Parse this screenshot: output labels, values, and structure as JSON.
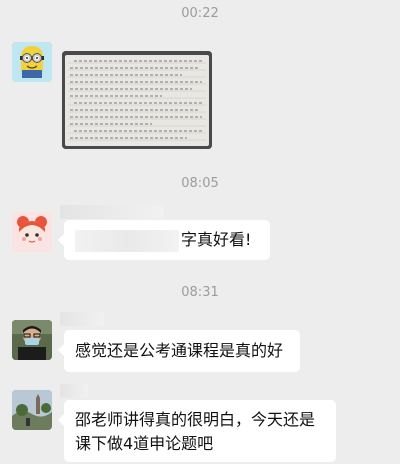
{
  "chat": {
    "timestamps": [
      "00:22",
      "08:05",
      "08:31"
    ],
    "messages": [
      {
        "type": "image",
        "image_desc": "handwritten-essay-photo",
        "avatar_icon": "minion-avatar"
      },
      {
        "type": "text",
        "text": "字真好看!",
        "avatar_icon": "cartoon-girl-avatar"
      },
      {
        "type": "text",
        "text": "感觉还是公考通课程是真的好",
        "avatar_icon": "man-with-mask-avatar"
      },
      {
        "type": "text",
        "text_line1": "邵老师讲得真的很明白，今天还是",
        "text_line2": "课下做4道申论题吧",
        "avatar_icon": "landscape-avatar"
      }
    ]
  },
  "colors": {
    "background": "#ededed",
    "bubble": "#ffffff",
    "timestamp": "#9c9c9c",
    "text": "#111111"
  }
}
